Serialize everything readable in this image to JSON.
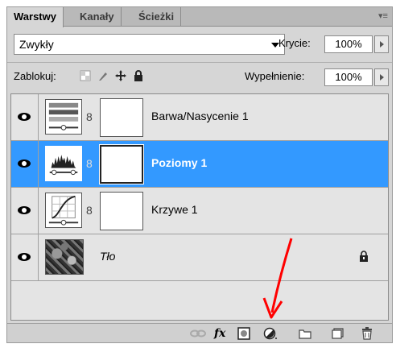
{
  "tabs": [
    {
      "label": "Warstwy",
      "active": true
    },
    {
      "label": "Kanały",
      "active": false
    },
    {
      "label": "Ścieżki",
      "active": false
    }
  ],
  "blend_mode": "Zwykły",
  "opacity": {
    "label": "Krycie:",
    "value": "100%"
  },
  "lock": {
    "label": "Zablokuj:"
  },
  "fill": {
    "label": "Wypełnienie:",
    "value": "100%"
  },
  "layers": [
    {
      "name": "Barwa/Nasycenie 1",
      "type": "hue-saturation",
      "selected": false
    },
    {
      "name": "Poziomy 1",
      "type": "levels",
      "selected": true
    },
    {
      "name": "Krzywe 1",
      "type": "curves",
      "selected": false
    },
    {
      "name": "Tło",
      "type": "background",
      "selected": false,
      "locked": true
    }
  ],
  "toolbar": {
    "icons": [
      "link-icon",
      "fx-icon",
      "add-mask-icon",
      "new-adjustment-layer-icon",
      "new-group-icon",
      "new-layer-icon",
      "trash-icon"
    ],
    "fx_label": "fx"
  },
  "colors": {
    "selection": "#3399ff",
    "annotation_arrow": "#ff0000"
  }
}
